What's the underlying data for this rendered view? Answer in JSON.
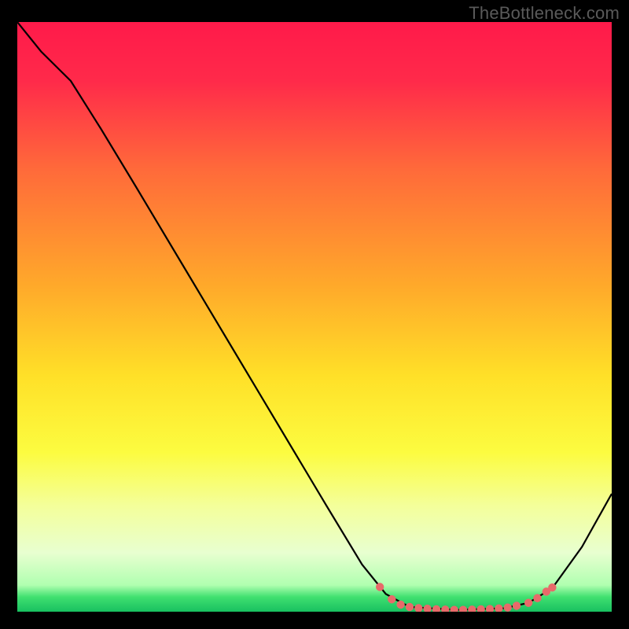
{
  "attribution": "TheBottleneck.com",
  "chart_data": {
    "type": "line",
    "title": "",
    "xlabel": "",
    "ylabel": "",
    "xlim": [
      0,
      100
    ],
    "ylim": [
      0,
      100
    ],
    "gradient_stops": [
      {
        "offset": 0.0,
        "color": "#ff1a4a"
      },
      {
        "offset": 0.1,
        "color": "#ff2a4a"
      },
      {
        "offset": 0.25,
        "color": "#ff6a3a"
      },
      {
        "offset": 0.45,
        "color": "#ffaa2a"
      },
      {
        "offset": 0.6,
        "color": "#ffe028"
      },
      {
        "offset": 0.73,
        "color": "#fcfc40"
      },
      {
        "offset": 0.82,
        "color": "#f4ff9a"
      },
      {
        "offset": 0.9,
        "color": "#e8ffd0"
      },
      {
        "offset": 0.955,
        "color": "#b0ffb0"
      },
      {
        "offset": 0.975,
        "color": "#40e070"
      },
      {
        "offset": 1.0,
        "color": "#18c060"
      }
    ],
    "series": [
      {
        "name": "curve",
        "color": "#000000",
        "points": [
          {
            "x": 0.0,
            "y": 100.0
          },
          {
            "x": 4.0,
            "y": 95.0
          },
          {
            "x": 7.0,
            "y": 92.0
          },
          {
            "x": 9.0,
            "y": 90.0
          },
          {
            "x": 14.0,
            "y": 82.0
          },
          {
            "x": 20.0,
            "y": 72.0
          },
          {
            "x": 28.0,
            "y": 58.5
          },
          {
            "x": 36.0,
            "y": 45.0
          },
          {
            "x": 44.0,
            "y": 31.5
          },
          {
            "x": 52.0,
            "y": 18.0
          },
          {
            "x": 58.0,
            "y": 8.0
          },
          {
            "x": 62.0,
            "y": 3.0
          },
          {
            "x": 66.0,
            "y": 0.8
          },
          {
            "x": 74.0,
            "y": 0.3
          },
          {
            "x": 82.0,
            "y": 0.6
          },
          {
            "x": 86.0,
            "y": 1.5
          },
          {
            "x": 90.0,
            "y": 4.0
          },
          {
            "x": 95.0,
            "y": 11.0
          },
          {
            "x": 100.0,
            "y": 20.0
          }
        ]
      }
    ],
    "markers": {
      "name": "highlight",
      "color": "#e86a6a",
      "points": [
        {
          "x": 61.0,
          "y": 4.2
        },
        {
          "x": 63.0,
          "y": 2.1
        },
        {
          "x": 64.5,
          "y": 1.2
        },
        {
          "x": 66.0,
          "y": 0.8
        },
        {
          "x": 67.5,
          "y": 0.6
        },
        {
          "x": 69.0,
          "y": 0.5
        },
        {
          "x": 70.5,
          "y": 0.4
        },
        {
          "x": 72.0,
          "y": 0.35
        },
        {
          "x": 73.5,
          "y": 0.3
        },
        {
          "x": 75.0,
          "y": 0.3
        },
        {
          "x": 76.5,
          "y": 0.35
        },
        {
          "x": 78.0,
          "y": 0.4
        },
        {
          "x": 79.5,
          "y": 0.45
        },
        {
          "x": 81.0,
          "y": 0.55
        },
        {
          "x": 82.5,
          "y": 0.7
        },
        {
          "x": 84.0,
          "y": 1.0
        },
        {
          "x": 86.0,
          "y": 1.5
        },
        {
          "x": 87.5,
          "y": 2.3
        },
        {
          "x": 89.0,
          "y": 3.4
        },
        {
          "x": 90.0,
          "y": 4.1
        }
      ]
    }
  }
}
